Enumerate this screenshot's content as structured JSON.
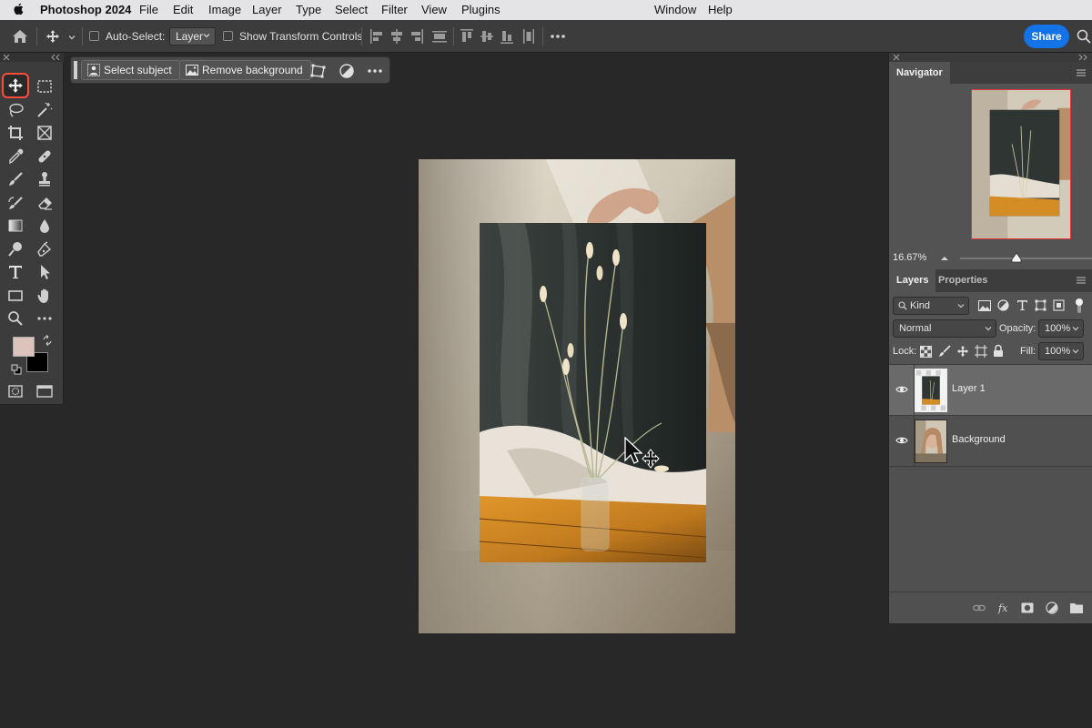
{
  "menubar": {
    "app_name": "Photoshop 2024",
    "items": [
      "File",
      "Edit",
      "Image",
      "Layer",
      "Type",
      "Select",
      "Filter",
      "View",
      "Plugins",
      "Window",
      "Help"
    ]
  },
  "options_bar": {
    "auto_select_label": "Auto-Select:",
    "auto_select_value": "Layer",
    "show_transform_label": "Show Transform Controls",
    "share_label": "Share"
  },
  "contextual_task_bar": {
    "select_subject_label": "Select subject",
    "remove_background_label": "Remove background"
  },
  "toolbox": {
    "active_tool": "move-tool",
    "foreground_color": "#dcc3bb",
    "background_color": "#000000"
  },
  "navigator": {
    "tab_label": "Navigator",
    "zoom": "16.67%"
  },
  "layers_panel": {
    "tabs": [
      "Layers",
      "Properties"
    ],
    "filter_label": "Kind",
    "blend_mode": "Normal",
    "opacity_label": "Opacity:",
    "opacity_value": "100%",
    "lock_label": "Lock:",
    "fill_label": "Fill:",
    "fill_value": "100%",
    "layers": [
      {
        "name": "Layer 1",
        "selected": true,
        "visible": true
      },
      {
        "name": "Background",
        "selected": false,
        "visible": true
      }
    ]
  },
  "colors": {
    "accent": "#1473e6",
    "active_tool_highlight": "#ff4b3a",
    "navigator_frame": "#e0353a"
  }
}
